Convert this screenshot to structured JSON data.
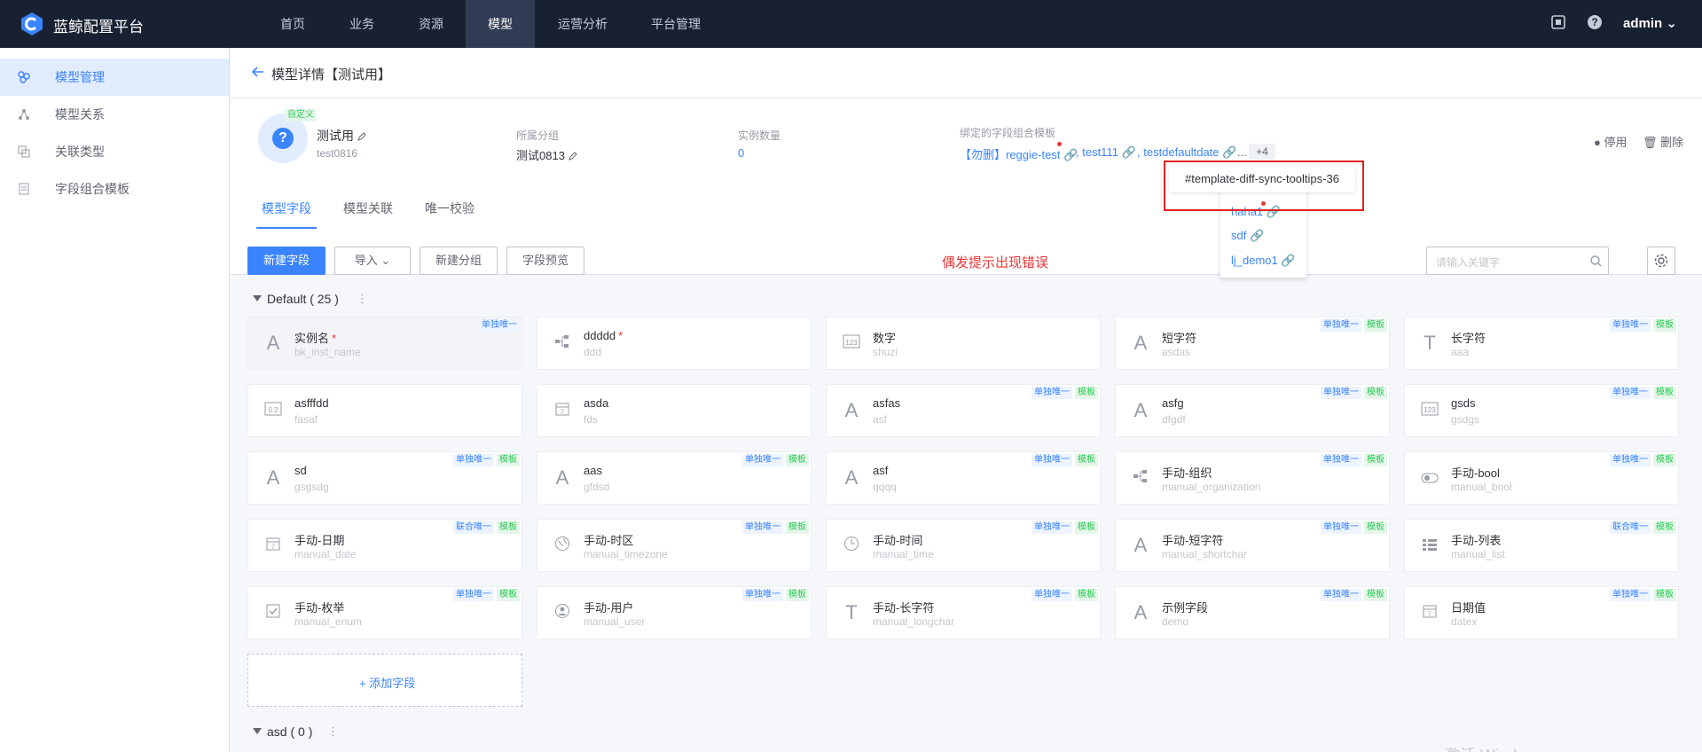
{
  "app": {
    "brand": "蓝鲸配置平台",
    "user": "admin"
  },
  "nav": [
    "首页",
    "业务",
    "资源",
    "模型",
    "运营分析",
    "平台管理"
  ],
  "sidebar": [
    "模型管理",
    "模型关系",
    "关联类型",
    "字段组合模板"
  ],
  "page": {
    "title": "模型详情【测试用】"
  },
  "model": {
    "custom_tag": "自定义",
    "name": "测试用",
    "id": "test0816",
    "group_label": "所属分组",
    "group_value": "测试0813",
    "count_label": "实例数量",
    "count_value": "0",
    "template_label": "绑定的字段组合模板",
    "templates": [
      "【勿删】reggie-test",
      ", test111",
      ", testdefaultdate",
      "..."
    ],
    "more": "+4",
    "actions": {
      "disable": "停用",
      "delete": "删除"
    }
  },
  "tabs": [
    "模型字段",
    "模型关联",
    "唯一校验"
  ],
  "toolbar": {
    "new_field": "新建字段",
    "import": "导入",
    "new_group": "新建分组",
    "preview": "字段预览",
    "search_placeholder": "请输入关键字"
  },
  "annotation": "偶发提示出现错误",
  "tooltip": "#template-diff-sync-tooltips-36",
  "popover_items": [
    "haha1",
    "sdf",
    "lj_demo1"
  ],
  "groups": [
    {
      "name": "Default ( 25 )"
    },
    {
      "name": "asd ( 0 )"
    }
  ],
  "tag_only": "单独唯一",
  "tag_union": "联合唯一",
  "tag_template": "模板",
  "add_field": "+ 添加字段",
  "fields": [
    {
      "name": "实例名",
      "id": "bk_inst_name",
      "icon": "A",
      "req": "*",
      "only": "单独唯一",
      "tpl": ""
    },
    {
      "name": "ddddd",
      "id": "ddd",
      "icon": "org",
      "req": "*",
      "only": "",
      "tpl": ""
    },
    {
      "name": "数字",
      "id": "shuzi",
      "icon": "123",
      "req": "",
      "only": "",
      "tpl": ""
    },
    {
      "name": "短字符",
      "id": "asdas",
      "icon": "A",
      "req": "",
      "only": "单独唯一",
      "tpl": "模板"
    },
    {
      "name": "长字符",
      "id": "aaa",
      "icon": "T",
      "req": "",
      "only": "单独唯一",
      "tpl": "模板"
    },
    {
      "name": "asfffdd",
      "id": "fasaf",
      "icon": "0.2",
      "req": "",
      "only": "",
      "tpl": ""
    },
    {
      "name": "asda",
      "id": "fds",
      "icon": "cal",
      "req": "",
      "only": "",
      "tpl": ""
    },
    {
      "name": "asfas",
      "id": "asf",
      "icon": "A",
      "req": "",
      "only": "单独唯一",
      "tpl": "模板"
    },
    {
      "name": "asfg",
      "id": "dfgdf",
      "icon": "A",
      "req": "",
      "only": "单独唯一",
      "tpl": "模板"
    },
    {
      "name": "gsds",
      "id": "gsdgs",
      "icon": "123",
      "req": "",
      "only": "单独唯一",
      "tpl": "模板"
    },
    {
      "name": "sd",
      "id": "gsgsdg",
      "icon": "A",
      "req": "",
      "only": "单独唯一",
      "tpl": "模板"
    },
    {
      "name": "aas",
      "id": "gfdsd",
      "icon": "A",
      "req": "",
      "only": "单独唯一",
      "tpl": "模板"
    },
    {
      "name": "asf",
      "id": "qqqq",
      "icon": "A",
      "req": "",
      "only": "单独唯一",
      "tpl": "模板"
    },
    {
      "name": "手动-组织",
      "id": "manual_organization",
      "icon": "org",
      "req": "",
      "only": "单独唯一",
      "tpl": "模板"
    },
    {
      "name": "手动-bool",
      "id": "manual_bool",
      "icon": "bool",
      "req": "",
      "only": "单独唯一",
      "tpl": "模板"
    },
    {
      "name": "手动-日期",
      "id": "manual_date",
      "icon": "cal",
      "req": "",
      "only": "联合唯一",
      "tpl": "模板"
    },
    {
      "name": "手动-时区",
      "id": "manual_timezone",
      "icon": "globe",
      "req": "",
      "only": "单独唯一",
      "tpl": "模板"
    },
    {
      "name": "手动-时间",
      "id": "manual_time",
      "icon": "clock",
      "req": "",
      "only": "单独唯一",
      "tpl": "模板"
    },
    {
      "name": "手动-短字符",
      "id": "manual_shortchar",
      "icon": "A",
      "req": "",
      "only": "单独唯一",
      "tpl": "模板"
    },
    {
      "name": "手动-列表",
      "id": "manual_list",
      "icon": "list",
      "req": "",
      "only": "联合唯一",
      "tpl": "模板"
    },
    {
      "name": "手动-枚举",
      "id": "manual_enum",
      "icon": "check",
      "req": "",
      "only": "单独唯一",
      "tpl": "模板"
    },
    {
      "name": "手动-用户",
      "id": "manual_user",
      "icon": "user",
      "req": "",
      "only": "单独唯一",
      "tpl": "模板"
    },
    {
      "name": "手动-长字符",
      "id": "manual_longchar",
      "icon": "T",
      "req": "",
      "only": "单独唯一",
      "tpl": "模板"
    },
    {
      "name": "示例字段",
      "id": "demo",
      "icon": "A",
      "req": "",
      "only": "单独唯一",
      "tpl": "模板"
    },
    {
      "name": "日期值",
      "id": "datex",
      "icon": "cal",
      "req": "",
      "only": "单独唯一",
      "tpl": "模板"
    }
  ],
  "watermark": "激活 Windows",
  "colors": {
    "nav_bg": "#182132",
    "accent": "#3a84ff",
    "danger": "#ea3636",
    "success": "#2dcb56"
  }
}
